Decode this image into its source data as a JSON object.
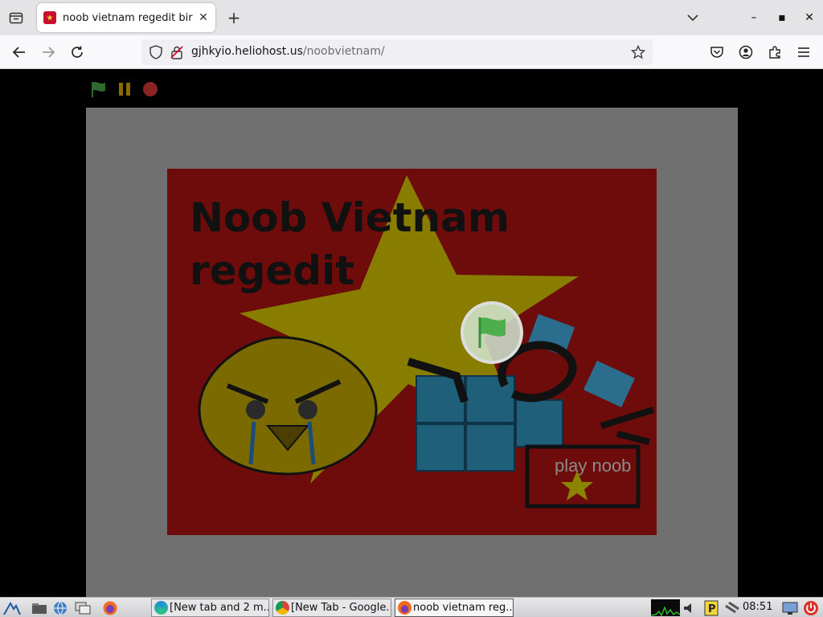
{
  "browser": {
    "tab": {
      "title": "noob vietnam regedit bird",
      "close_glyph": "✕"
    },
    "new_tab_glyph": "+",
    "window": {
      "minimize": "–",
      "maximize": "▪",
      "close": "✕"
    },
    "url": {
      "domain": "gjhkyio.heliohost.us",
      "path": "/noobvietnam/"
    }
  },
  "stage": {
    "title": "Noob Vietnam regedit",
    "play_button_label": "play noob",
    "colors": {
      "background": "#6e0b0b",
      "star": "#b7a900",
      "cube": "#1f5f7a",
      "frame": "#707070"
    }
  },
  "taskbar": {
    "windows": [
      {
        "label": "[New tab and 2 m...",
        "icon": "edge-icon"
      },
      {
        "label": "[New Tab - Google...",
        "icon": "chrome-icon"
      },
      {
        "label": "noob vietnam reg...",
        "icon": "firefox-icon"
      }
    ],
    "clock": "08:51"
  }
}
